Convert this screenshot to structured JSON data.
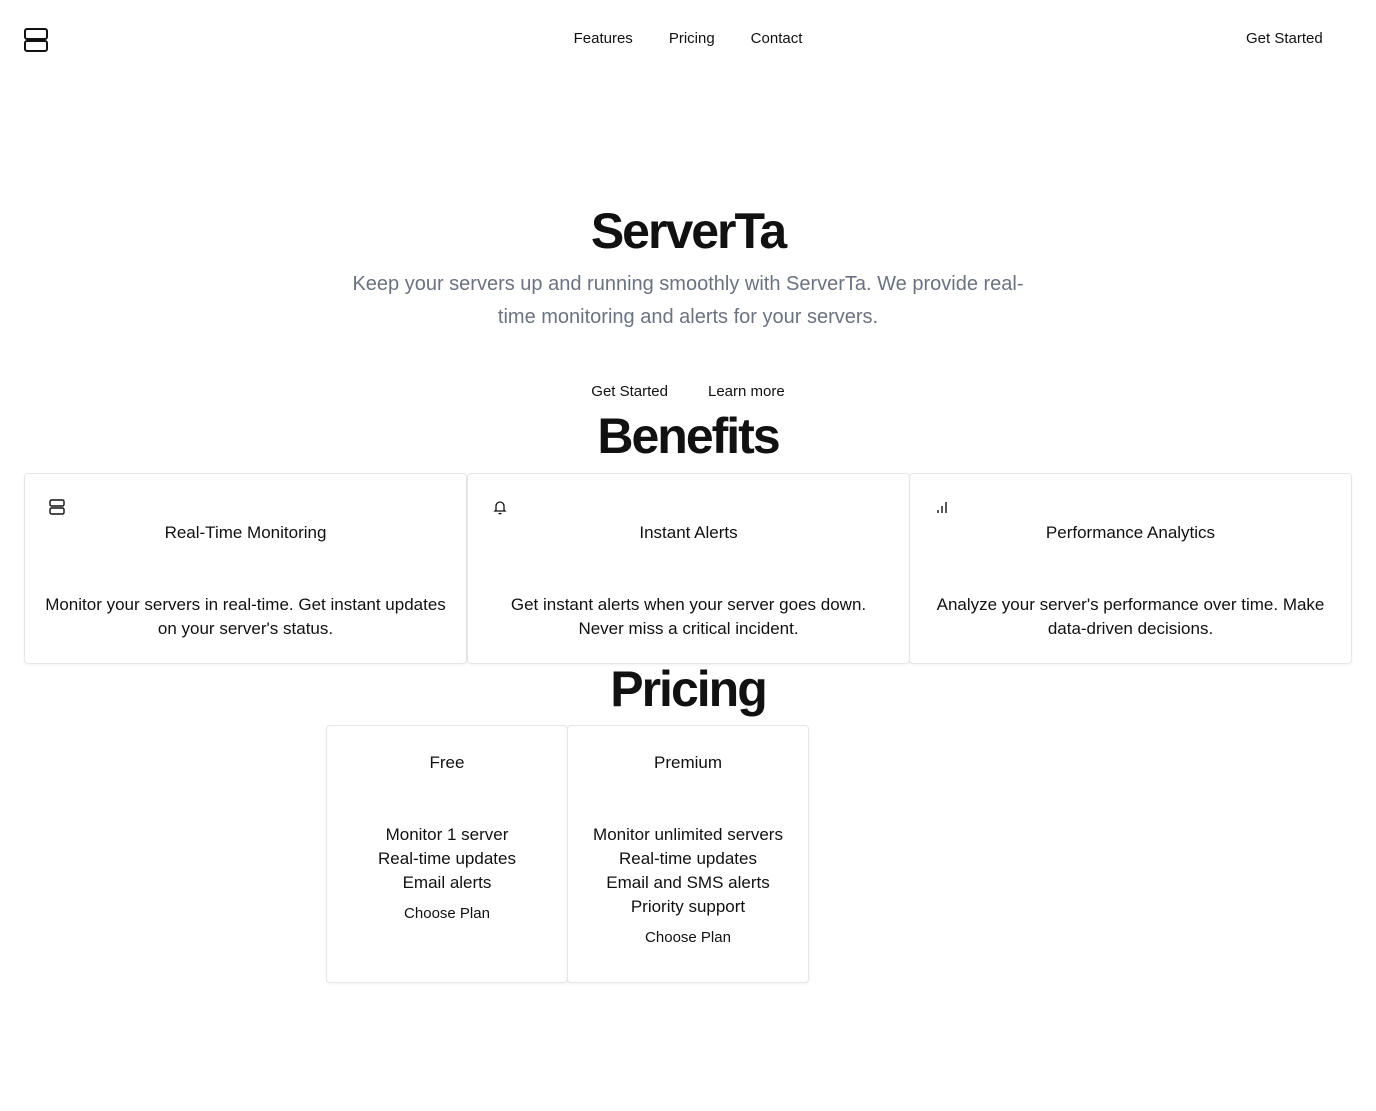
{
  "header": {
    "logo_icon": "server-icon",
    "nav": [
      "Features",
      "Pricing",
      "Contact"
    ],
    "cta": "Get Started"
  },
  "hero": {
    "title": "ServerTa",
    "subtitle": "Keep your servers up and running smoothly with ServerTa. We provide real-time monitoring and alerts for your servers.",
    "primary_action": "Get Started",
    "secondary_action": "Learn more"
  },
  "benefits": {
    "heading": "Benefits",
    "items": [
      {
        "icon": "server-icon",
        "title": "Real-Time Monitoring",
        "description": "Monitor your servers in real-time. Get instant updates on your server's status."
      },
      {
        "icon": "bell-icon",
        "title": "Instant Alerts",
        "description": "Get instant alerts when your server goes down. Never miss a critical incident."
      },
      {
        "icon": "bar-chart-icon",
        "title": "Performance Analytics",
        "description": "Analyze your server's performance over time. Make data-driven decisions."
      }
    ]
  },
  "pricing": {
    "heading": "Pricing",
    "plans": [
      {
        "name": "Free",
        "features": [
          "Monitor 1 server",
          "Real-time updates",
          "Email alerts"
        ],
        "action": "Choose Plan"
      },
      {
        "name": "Premium",
        "features": [
          "Monitor unlimited servers",
          "Real-time updates",
          "Email and SMS alerts",
          "Priority support"
        ],
        "action": "Choose Plan"
      }
    ]
  }
}
